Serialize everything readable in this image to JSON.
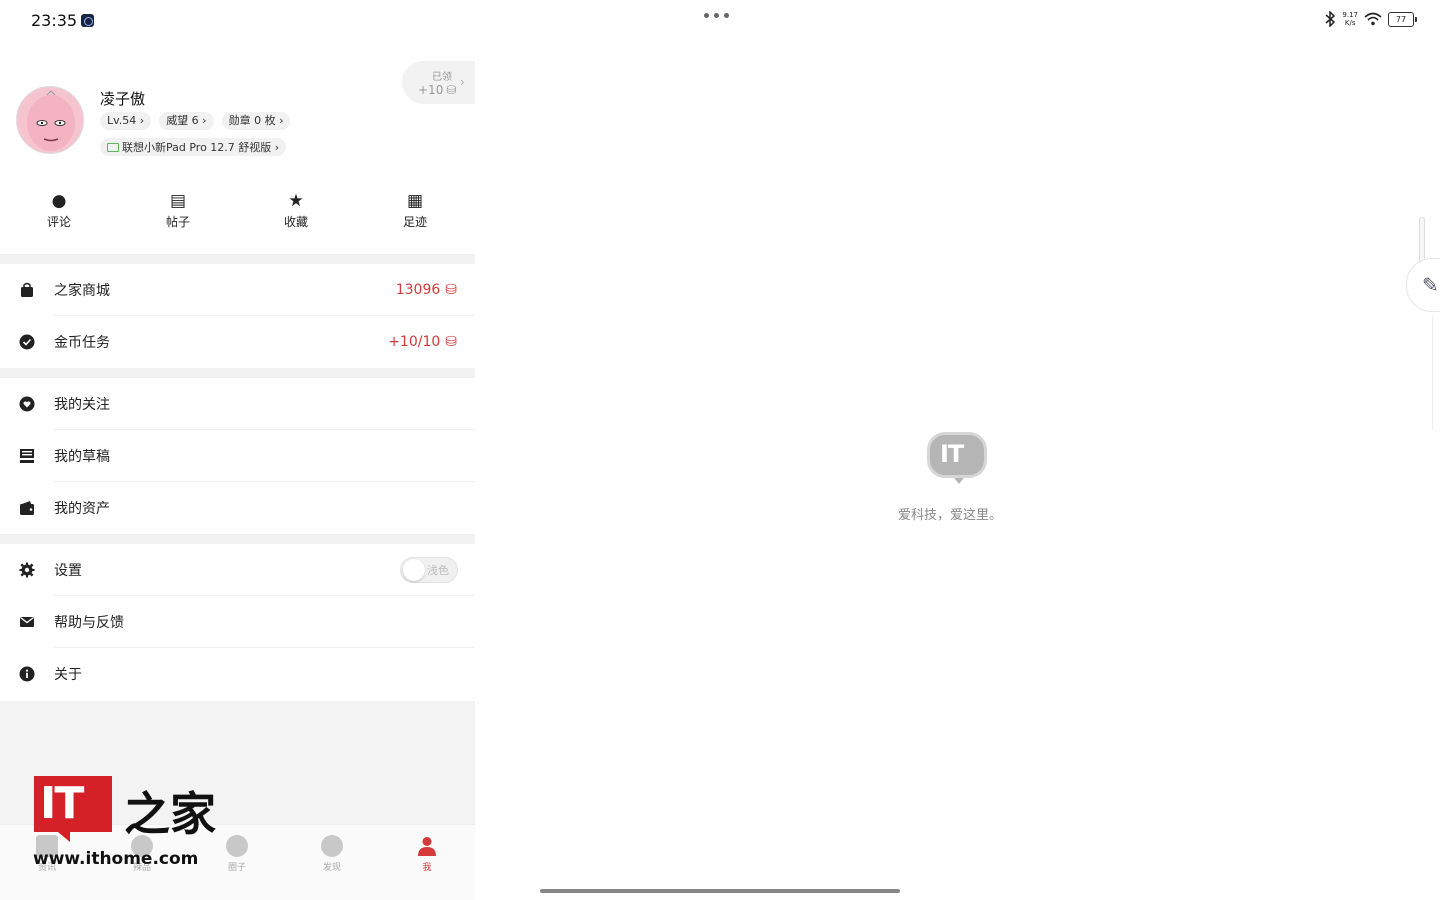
{
  "status_bar": {
    "time": "23:35",
    "net_speed_value": "9.17",
    "net_speed_unit": "K/s",
    "battery": "77"
  },
  "profile": {
    "username": "凌子傲",
    "level": "Lv.54 ›",
    "prestige": "威望 6 ›",
    "medals": "勋章 0 枚 ›",
    "device": "联想小新Pad Pro 12.7 舒视版 ›",
    "claimed_label": "已领",
    "claimed_value": "+10"
  },
  "quick_actions": [
    {
      "label": "评论",
      "icon": "comment-icon"
    },
    {
      "label": "帖子",
      "icon": "post-icon"
    },
    {
      "label": "收藏",
      "icon": "star-icon"
    },
    {
      "label": "足迹",
      "icon": "calendar-icon"
    }
  ],
  "menu": {
    "mall": {
      "label": "之家商城",
      "value": "13096"
    },
    "coin_task": {
      "label": "金币任务",
      "value": "+10/10"
    },
    "follow": {
      "label": "我的关注"
    },
    "drafts": {
      "label": "我的草稿"
    },
    "assets": {
      "label": "我的资产"
    },
    "settings": {
      "label": "设置",
      "toggle_label": "浅色"
    },
    "help": {
      "label": "帮助与反馈"
    },
    "about": {
      "label": "关于"
    }
  },
  "bottom_nav": [
    {
      "label": "资讯"
    },
    {
      "label": "辣品"
    },
    {
      "label": "圈子"
    },
    {
      "label": "发现"
    },
    {
      "label": "我"
    }
  ],
  "watermark": {
    "logo": "IT",
    "name": "之家",
    "url": "www.ithome.com"
  },
  "empty_state": {
    "logo_text": "IT",
    "slogan": "爱科技，爱这里。"
  },
  "colors": {
    "accent": "#d43a3a",
    "divider": "#f2f2f2"
  }
}
